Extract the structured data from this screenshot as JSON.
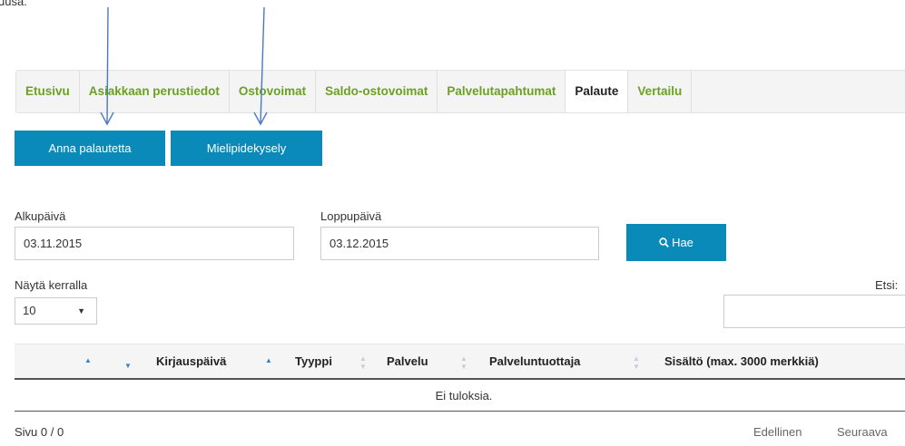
{
  "top_fragment": "uusa.",
  "tabs": [
    {
      "label": "Etusivu",
      "active": false
    },
    {
      "label": "Asiakkaan perustiedot",
      "active": false
    },
    {
      "label": "Ostovoimat",
      "active": false
    },
    {
      "label": "Saldo-ostovoimat",
      "active": false
    },
    {
      "label": "Palvelutapahtumat",
      "active": false
    },
    {
      "label": "Palaute",
      "active": true
    },
    {
      "label": "Vertailu",
      "active": false
    }
  ],
  "buttons": {
    "feedback": "Anna palautetta",
    "survey": "Mielipidekysely",
    "search": "Hae"
  },
  "filters": {
    "start_label": "Alkupäivä",
    "start_value": "03.11.2015",
    "end_label": "Loppupäivä",
    "end_value": "03.12.2015"
  },
  "page_size": {
    "label": "Näytä kerralla",
    "value": "10"
  },
  "search": {
    "label": "Etsi:",
    "value": ""
  },
  "table": {
    "columns": [
      "Kirjauspäivä",
      "Tyyppi",
      "Palvelu",
      "Palveluntuottaja",
      "Sisältö (max. 3000 merkkiä)"
    ],
    "empty_text": "Ei tuloksia."
  },
  "pager": {
    "info": "Sivu 0 / 0",
    "prev": "Edellinen",
    "next": "Seuraava"
  },
  "colors": {
    "accent_blue": "#0a8ab8",
    "tab_green": "#6aa121",
    "arrow": "#4a78c0"
  },
  "icons": [
    "search-icon",
    "caret-down-icon",
    "sort-asc-icon",
    "sort-desc-icon",
    "sort-both-icon",
    "arrow-annotation"
  ]
}
